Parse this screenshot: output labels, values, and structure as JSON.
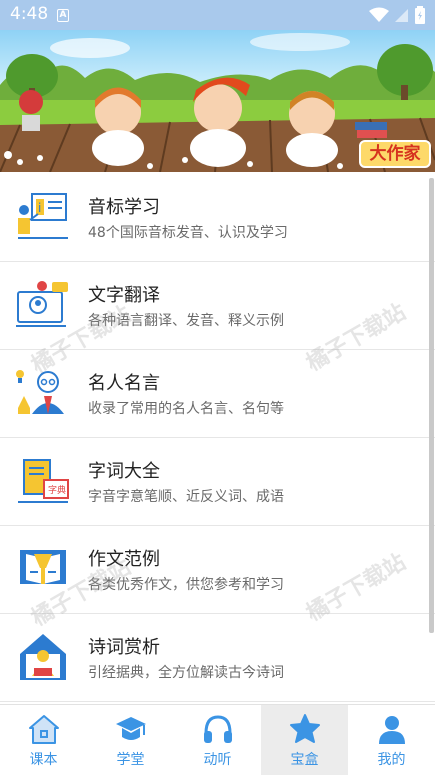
{
  "status": {
    "time": "4:48",
    "notif_letter": "A"
  },
  "banner": {
    "badge": "大作家"
  },
  "items": [
    {
      "title": "音标学习",
      "subtitle": "48个国际音标发音、认识及学习",
      "icon": "phonetic-board-icon"
    },
    {
      "title": "文字翻译",
      "subtitle": "各种语言翻译、发音、释义示例",
      "icon": "translator-screen-icon"
    },
    {
      "title": "名人名言",
      "subtitle": "收录了常用的名人名言、名句等",
      "icon": "scientist-icon"
    },
    {
      "title": "字词大全",
      "subtitle": "字音字意笔顺、近反义词、成语",
      "icon": "dictionary-icon"
    },
    {
      "title": "作文范例",
      "subtitle": "各类优秀作文，供您参考和学习",
      "icon": "writing-book-icon"
    },
    {
      "title": "诗词赏析",
      "subtitle": "引经据典，全方位解读古今诗词",
      "icon": "poetry-reader-icon"
    }
  ],
  "watermark": "橘子下载站",
  "tabs": [
    {
      "label": "课本",
      "icon": "house-icon",
      "active": false
    },
    {
      "label": "学堂",
      "icon": "graduation-cap-icon",
      "active": false
    },
    {
      "label": "动听",
      "icon": "headphones-icon",
      "active": false
    },
    {
      "label": "宝盒",
      "icon": "star-icon",
      "active": true
    },
    {
      "label": "我的",
      "icon": "person-icon",
      "active": false
    }
  ],
  "colors": {
    "accent": "#3b94e4",
    "status_bar": "#a9c9ec",
    "badge_bg": "#fdd96a",
    "badge_text": "#d6331f"
  }
}
